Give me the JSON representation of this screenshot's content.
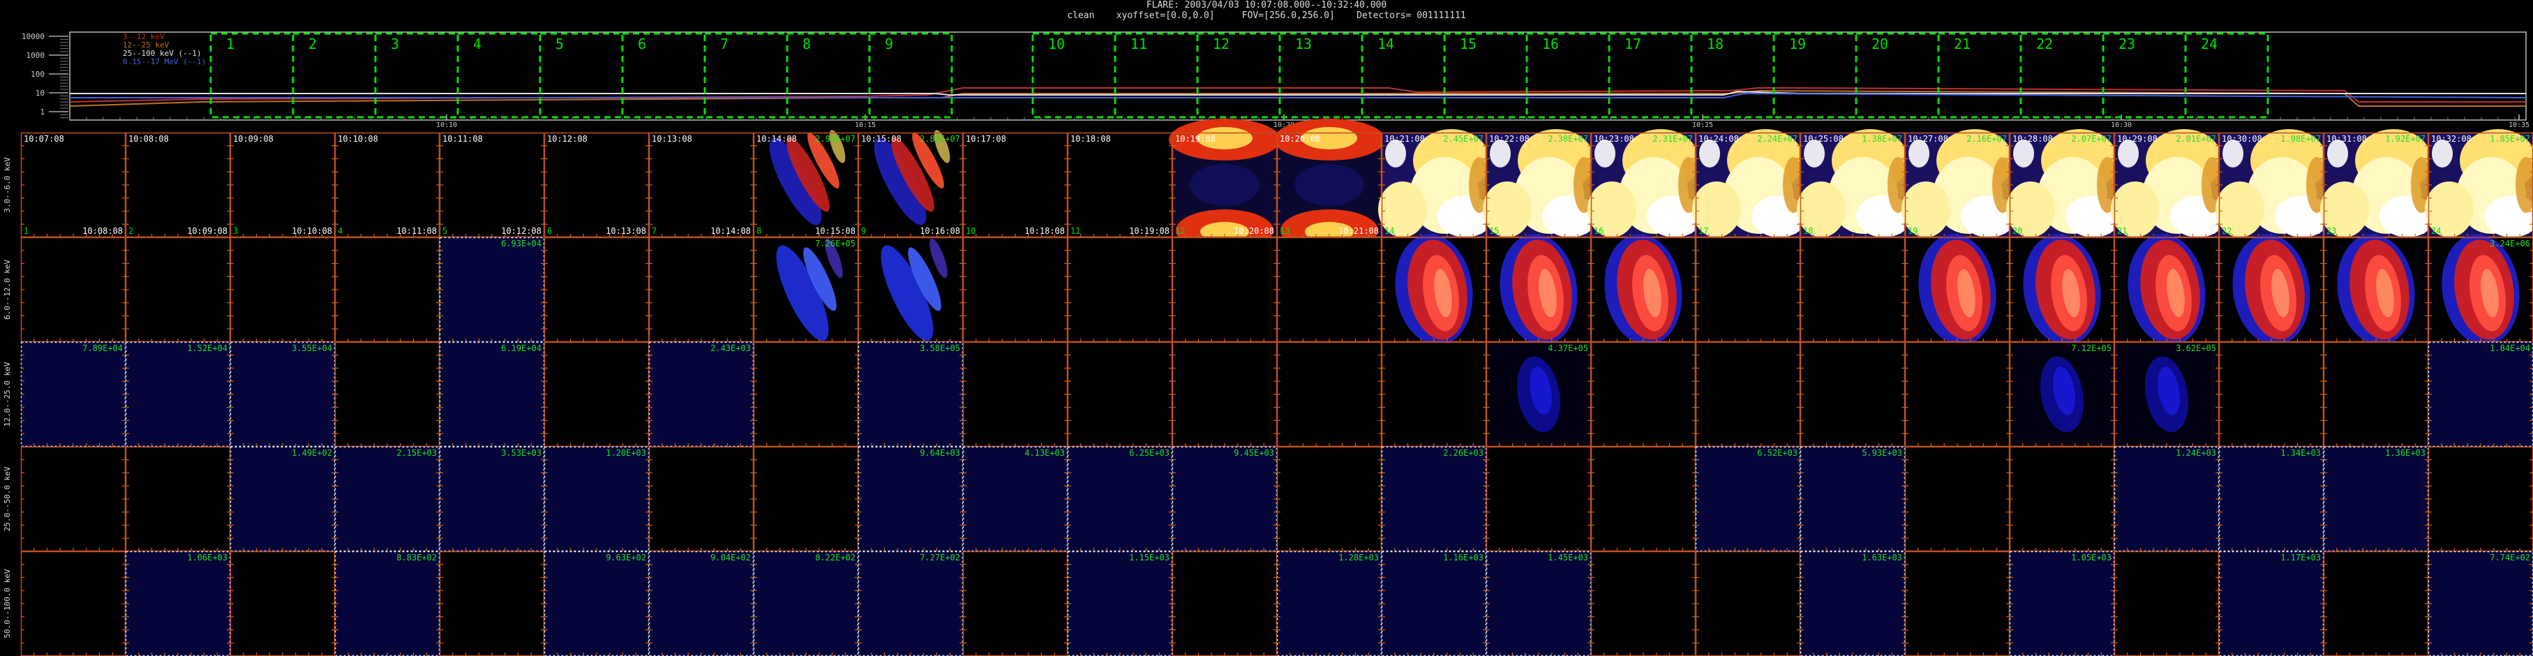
{
  "header": {
    "title": "FLARE: 2003/04/03 10:07:08.000--10:32:40.000",
    "line2_left": "clean",
    "line2_offset": "xyoffset=[0.0,0.0]",
    "line2_fov": "FOV=[256.0,256.0]",
    "line2_detectors": "Detectors= 001111111"
  },
  "lightcurve": {
    "ylabels": [
      "10000",
      "1000",
      "100",
      "10",
      "1"
    ],
    "legend": [
      {
        "label": "3--12 keV",
        "color": "#c03030"
      },
      {
        "label": "12--25 keV",
        "color": "#c07020"
      },
      {
        "label": "25--100 keV (--1)",
        "color": "#e0e0e0"
      },
      {
        "label": "0.15--17 MeV (--1)",
        "color": "#4060e0"
      }
    ],
    "xticks": [
      "10:10",
      "10:15",
      "10:20",
      "10:25",
      "10:30",
      "10:35"
    ],
    "boxes": [
      "1",
      "2",
      "3",
      "4",
      "5",
      "6",
      "7",
      "8",
      "9",
      "10",
      "11",
      "12",
      "13",
      "14",
      "15",
      "16",
      "17",
      "18",
      "19",
      "20",
      "21",
      "22",
      "23",
      "24"
    ]
  },
  "row_labels": [
    "3.0--6.0 keV",
    "6.0--12.0 keV",
    "12.0--25.0 keV",
    "25.0--50.0 keV",
    "50.0--100.0 keV"
  ],
  "start_times": [
    "10:07:08",
    "10:08:08",
    "10:09:08",
    "10:10:08",
    "10:11:08",
    "10:12:08",
    "10:13:08",
    "10:14:08",
    "10:15:08",
    "10:17:08",
    "10:18:08",
    "10:19:08",
    "10:20:08",
    "10:21:08",
    "10:22:08",
    "10:23:08",
    "10:24:08",
    "10:25:08",
    "10:27:08",
    "10:28:08",
    "10:29:08",
    "10:30:08",
    "10:31:08",
    "10:32:08"
  ],
  "end_times": [
    "10:08:08",
    "10:09:08",
    "10:10:08",
    "10:11:08",
    "10:12:08",
    "10:13:08",
    "10:14:08",
    "10:15:08",
    "10:16:08",
    "10:18:08",
    "10:19:08",
    "10:20:08",
    "10:21:08",
    "10:22:08",
    "10:23:08",
    "10:24:08",
    "10:25:08",
    "10:26:08",
    "10:28:08",
    "10:29:08",
    "10:30:08",
    "10:31:08",
    "10:32:08",
    "10:32:40"
  ],
  "max_values": {
    "row0": [
      "",
      "",
      "",
      "",
      "",
      "",
      "",
      "2.96E+07",
      "2.83E+07",
      "",
      "",
      "",
      "",
      "2.45E+07",
      "2.38E+07",
      "2.31E+07",
      "2.24E+07",
      "1.38E+07",
      "2.16E+07",
      "2.07E+07",
      "2.01E+07",
      "1.98E+07",
      "1.92E+07",
      "1.85E+07"
    ],
    "row1": [
      "",
      "",
      "",
      "",
      "6.93E+04",
      "",
      "",
      "7.26E+05",
      "",
      "",
      "",
      "",
      "",
      "",
      "",
      "",
      "",
      "",
      "",
      "",
      "",
      "",
      "",
      "3.24E+06"
    ],
    "row2": [
      "7.89E+04",
      "1.52E+04",
      "3.55E+04",
      "",
      "6.19E+04",
      "",
      "2.43E+03",
      "",
      "3.58E+05",
      "",
      "",
      "",
      "",
      "",
      "4.37E+05",
      "",
      "",
      "",
      "",
      "7.12E+05",
      "3.62E+05",
      "",
      "",
      "1.84E+04"
    ],
    "row3": [
      "",
      "",
      "1.49E+02",
      "2.15E+03",
      "3.53E+03",
      "1.20E+03",
      "",
      "",
      "9.64E+03",
      "4.13E+03",
      "6.25E+03",
      "9.45E+03",
      "",
      "2.26E+03",
      "",
      "",
      "6.52E+03",
      "5.93E+03",
      "",
      "",
      "1.24E+03",
      "1.34E+03",
      "1.36E+03",
      ""
    ],
    "row4": [
      "",
      "1.06E+03",
      "",
      "8.83E+02",
      "",
      "9.63E+02",
      "9.04E+02",
      "8.22E+02",
      "7.27E+02",
      "",
      "1.15E+03",
      "",
      "1.28E+03",
      "1.16E+03",
      "1.45E+03",
      "",
      "",
      "1.63E+03",
      "",
      "1.05E+03",
      "",
      "1.17E+03",
      "",
      "7.74E+02"
    ]
  },
  "colors": {
    "frame": "#c05020",
    "tick": "#d06010",
    "box": "#00e000",
    "time_text": "#ffffff",
    "maxval_text": "#20e020"
  }
}
